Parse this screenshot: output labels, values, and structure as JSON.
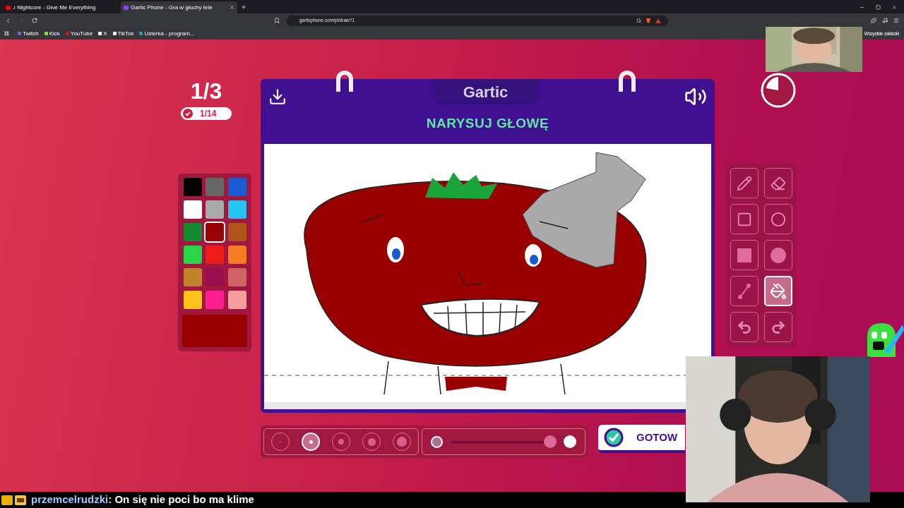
{
  "browser": {
    "tabs": [
      {
        "title": "♪ Nightcore - Give Me Everything",
        "selected": false
      },
      {
        "title": "Gartic Phone - Gra w głuchy tele",
        "selected": true
      }
    ],
    "address": "garticphone.com/pl/draw?1",
    "bookmarks": [
      {
        "label": "Twitch",
        "color": "#9146ff"
      },
      {
        "label": "Kick",
        "color": "#53fc18"
      },
      {
        "label": "YouTube",
        "color": "#ff0000"
      },
      {
        "label": "X",
        "color": "#ffffff"
      },
      {
        "label": "TikTok",
        "color": "#ffffff"
      },
      {
        "label": "Usterka - program...",
        "color": "#16a3b8"
      }
    ],
    "all_bookmarks": "Wszystkie zakładki"
  },
  "game": {
    "round": "1/3",
    "players_done": "1/14",
    "logo": "Gartic",
    "prompt": "NARYSUJ GŁOWĘ",
    "colors": [
      {
        "color": "#000000",
        "selected": false
      },
      {
        "color": "#666666",
        "selected": false
      },
      {
        "color": "#1a5ad1",
        "selected": false
      },
      {
        "color": "#ffffff",
        "selected": false
      },
      {
        "color": "#aaaaaa",
        "selected": false
      },
      {
        "color": "#28c3f5",
        "selected": false
      },
      {
        "color": "#138a2e",
        "selected": false
      },
      {
        "color": "#990000",
        "selected": true
      },
      {
        "color": "#b0551a",
        "selected": false
      },
      {
        "color": "#2bd54a",
        "selected": false
      },
      {
        "color": "#ee1c1c",
        "selected": false
      },
      {
        "color": "#f57c23",
        "selected": false
      },
      {
        "color": "#c1822b",
        "selected": false
      },
      {
        "color": "#9b0f4f",
        "selected": false
      },
      {
        "color": "#d06464",
        "selected": false
      },
      {
        "color": "#ffc21a",
        "selected": false
      },
      {
        "color": "#ff1f8e",
        "selected": false
      },
      {
        "color": "#f5a0a0",
        "selected": false
      }
    ],
    "brush_sizes": [
      {
        "selected": false
      },
      {
        "selected": true
      },
      {
        "selected": false
      },
      {
        "selected": false
      },
      {
        "selected": false
      }
    ],
    "opacity": {
      "level": 0.95
    },
    "done_button": "GOTOW",
    "tools": [
      {
        "kind": "pencil",
        "selected": false
      },
      {
        "kind": "eraser",
        "selected": false
      },
      {
        "kind": "rect",
        "selected": false
      },
      {
        "kind": "ellipse",
        "selected": false
      },
      {
        "kind": "rect-filled",
        "selected": false
      },
      {
        "kind": "ellipse-filled",
        "selected": false
      },
      {
        "kind": "line",
        "selected": false
      },
      {
        "kind": "fill",
        "selected": true
      },
      {
        "kind": "undo",
        "selected": false
      },
      {
        "kind": "redo",
        "selected": false
      }
    ]
  },
  "chat": {
    "user": "przemcelrudzki",
    "message": ": On się nie poci bo ma klime"
  }
}
